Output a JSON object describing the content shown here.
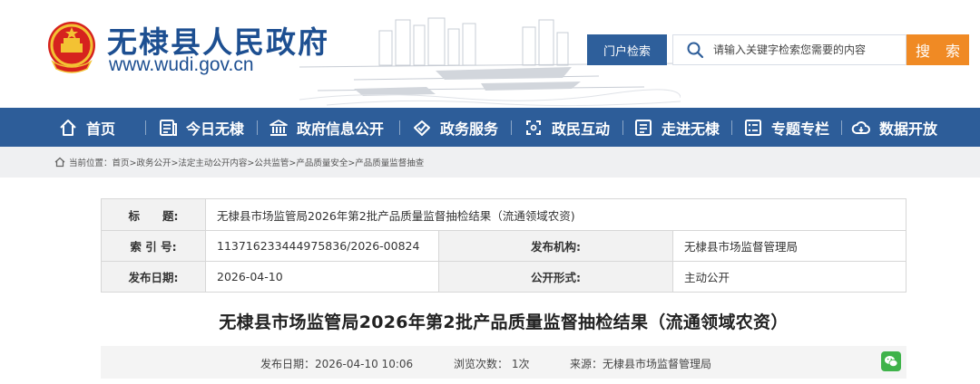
{
  "header": {
    "site_title": "无棣县人民政府",
    "site_url": "www.wudi.gov.cn",
    "portal_search_label": "门户检索",
    "search_placeholder": "请输入关键字检索您需要的内容",
    "search_button": "搜 索",
    "emblem_icon": "national-emblem-icon"
  },
  "nav": {
    "items": [
      {
        "label": "首页",
        "icon": "home-icon"
      },
      {
        "label": "今日无棣",
        "icon": "news-icon"
      },
      {
        "label": "政府信息公开",
        "icon": "government-building-icon"
      },
      {
        "label": "政务服务",
        "icon": "handshake-icon"
      },
      {
        "label": "政民互动",
        "icon": "interaction-icon"
      },
      {
        "label": "走进无棣",
        "icon": "document-icon"
      },
      {
        "label": "专题专栏",
        "icon": "list-icon"
      },
      {
        "label": "数据开放",
        "icon": "cloud-icon"
      }
    ]
  },
  "breadcrumb": {
    "text": "当前位置：首页>政务公开>法定主动公开内容>公共监管>产品质量安全>产品质量监督抽查"
  },
  "info": {
    "title_label": "标　　题:",
    "title_value": "无棣县市场监管局2026年第2批产品质量监督抽检结果（流通领域农资)",
    "index_label": "索 引 号:",
    "index_value": "113716233444975836/2026-00824",
    "publisher_label": "发布机构:",
    "publisher_value": "无棣县市场监督管理局",
    "date_label": "发布日期:",
    "date_value": "2026-04-10",
    "form_label": "公开形式:",
    "form_value": "主动公开"
  },
  "article": {
    "title": "无棣县市场监管局2026年第2批产品质量监督抽检结果（流通领域农资）",
    "publish_time": "发布日期：2026-04-10 10:06",
    "views": "浏览次数：  1次",
    "source": "来源：无棣县市场监督管理局"
  },
  "colors": {
    "brand_blue": "#1d4f91",
    "nav_blue": "#2d5d99",
    "search_orange": "#f08a24",
    "wechat_green": "#3fb34a"
  }
}
